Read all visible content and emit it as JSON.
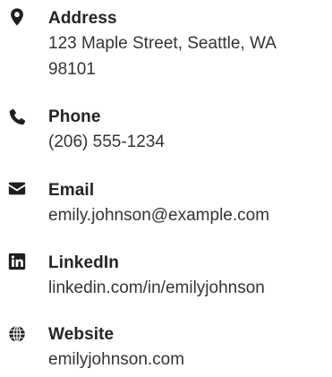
{
  "contact": {
    "items": [
      {
        "icon": "map-marker-icon",
        "label": "Address",
        "value": "123 Maple Street, Seattle, WA 98101"
      },
      {
        "icon": "phone-icon",
        "label": "Phone",
        "value": "(206) 555-1234"
      },
      {
        "icon": "envelope-icon",
        "label": "Email",
        "value": "emily.johnson@example.com"
      },
      {
        "icon": "linkedin-icon",
        "label": "LinkedIn",
        "value": "linkedin.com/in/emilyjohnson"
      },
      {
        "icon": "globe-icon",
        "label": "Website",
        "value": "emilyjohnson.com"
      }
    ]
  },
  "colors": {
    "icon": "#1e1e1e",
    "label": "#232323",
    "value": "#333333"
  }
}
